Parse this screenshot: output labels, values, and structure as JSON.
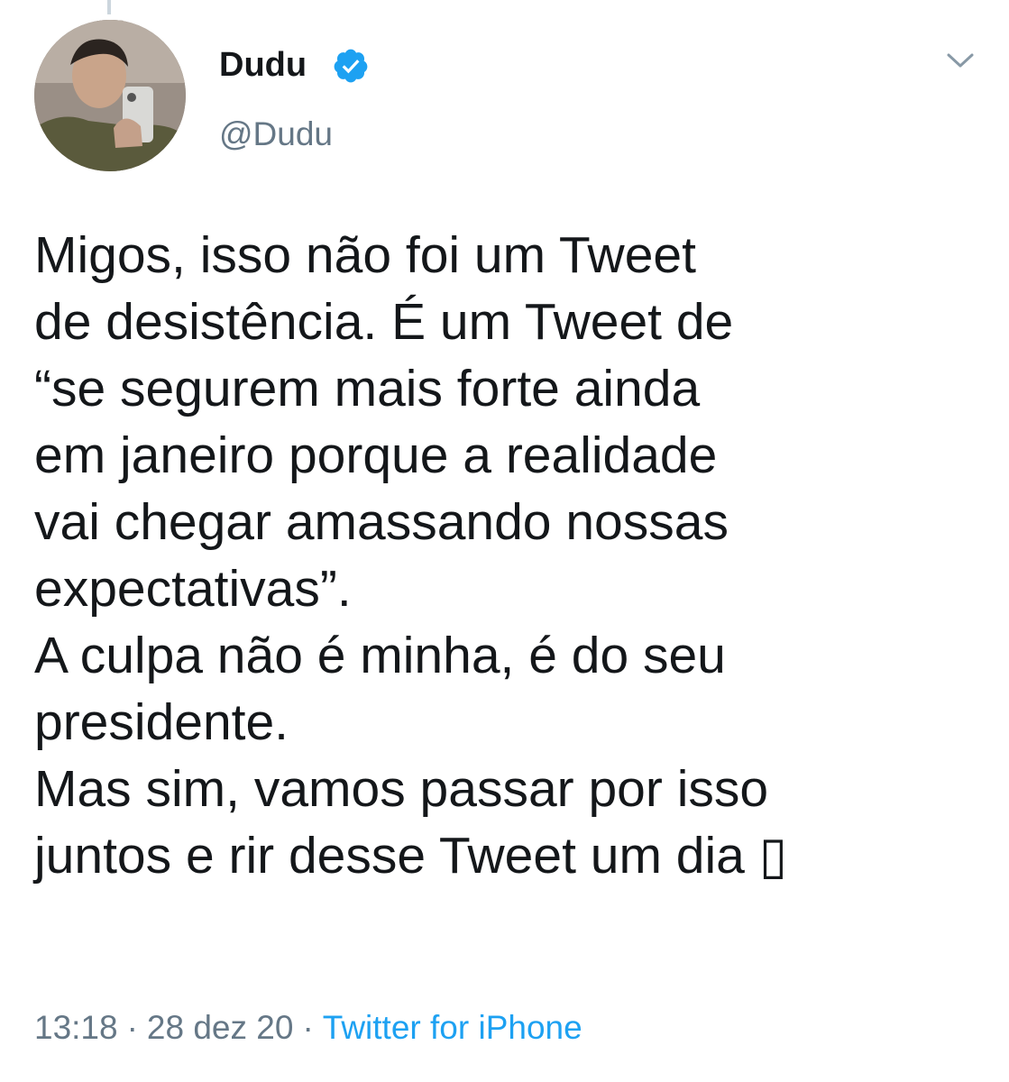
{
  "author": {
    "name": "Dudu",
    "handle": "@Dudu",
    "verified": true
  },
  "icons": {
    "verified": "verified-badge-icon",
    "menu": "chevron-down-icon"
  },
  "tweet": {
    "text": "Migos, isso não foi um Tweet\nde desistência. É um Tweet de\n“se segurem mais forte ainda\nem janeiro porque a realidade\nvai chegar amassando nossas\nexpectativas”.\nA culpa não é minha, é do seu\npresidente.\nMas sim, vamos passar por isso\njuntos e rir desse Tweet um dia ",
    "emoji_unrendered": "▯",
    "time": "13:18",
    "date": "28 dez 20",
    "separator": "·",
    "source": "Twitter for iPhone"
  },
  "colors": {
    "text": "#14171a",
    "secondary": "#657786",
    "accent": "#1da1f2",
    "thread_line": "#ccd6dd"
  }
}
